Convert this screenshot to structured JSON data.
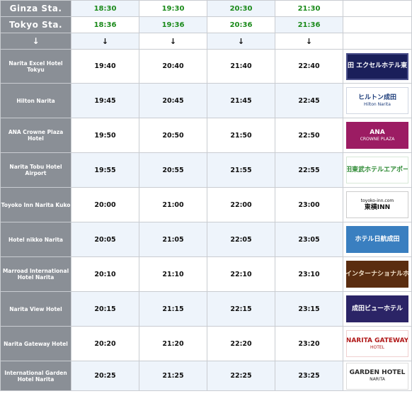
{
  "stations": [
    {
      "label": "Ginza Sta.",
      "times": [
        "18:30",
        "19:30",
        "20:30",
        "21:30"
      ]
    },
    {
      "label": "Tokyo Sta.",
      "times": [
        "18:36",
        "19:36",
        "20:36",
        "21:36"
      ]
    }
  ],
  "arrow_row": {
    "label": "↓",
    "cells": [
      "↓",
      "↓",
      "↓",
      "↓"
    ]
  },
  "hotels": [
    {
      "name": "Narita Excel Hotel Tokyu",
      "times": [
        "19:40",
        "20:40",
        "21:40",
        "22:40"
      ],
      "logo": {
        "line1": "成田 エクセルホテル東急",
        "line2": ""
      }
    },
    {
      "name": "Hilton Narita",
      "times": [
        "19:45",
        "20:45",
        "21:45",
        "22:45"
      ],
      "logo": {
        "line1": "ヒルトン成田",
        "line2": "Hilton Narita"
      }
    },
    {
      "name": "ANA Crowne Plaza Hotel",
      "times": [
        "19:50",
        "20:50",
        "21:50",
        "22:50"
      ],
      "logo": {
        "line1": "ANA",
        "line2": "CROWNE PLAZA"
      }
    },
    {
      "name": "Narita Tobu Hotel Airport",
      "times": [
        "19:55",
        "20:55",
        "21:55",
        "22:55"
      ],
      "logo": {
        "line1": "成田東武ホテルエアポート",
        "line2": ""
      }
    },
    {
      "name": "Toyoko Inn Narita Kuko",
      "times": [
        "20:00",
        "21:00",
        "22:00",
        "23:00"
      ],
      "logo": {
        "line1": "東横INN",
        "line2": "toyoko-inn.com"
      }
    },
    {
      "name": "Hotel nikko Narita",
      "times": [
        "20:05",
        "21:05",
        "22:05",
        "23:05"
      ],
      "logo": {
        "line1": "ホテル日航成田",
        "line2": ""
      }
    },
    {
      "name": "Marroad International Hotel Narita",
      "times": [
        "20:10",
        "21:10",
        "22:10",
        "23:10"
      ],
      "logo": {
        "line1": "マロウドインターナショナルホテル成田",
        "line2": ""
      }
    },
    {
      "name": "Narita View Hotel",
      "times": [
        "20:15",
        "21:15",
        "22:15",
        "23:15"
      ],
      "logo": {
        "line1": "成田ビューホテル",
        "line2": ""
      }
    },
    {
      "name": "Narita Gateway Hotel",
      "times": [
        "20:20",
        "21:20",
        "22:20",
        "23:20"
      ],
      "logo": {
        "line1": "NARITA GATEWAY",
        "line2": "HOTEL"
      }
    },
    {
      "name": "International Garden Hotel Narita",
      "times": [
        "20:25",
        "21:25",
        "22:25",
        "23:25"
      ],
      "logo": {
        "line1": "GARDEN HOTEL",
        "line2": "NARITA"
      }
    }
  ],
  "colors": {
    "station_header_bg": "#8a8f96",
    "departure_time_text": "#1a8a1a",
    "alt_row_bg": "#eef4fb",
    "grid": "#c9ccd1"
  }
}
